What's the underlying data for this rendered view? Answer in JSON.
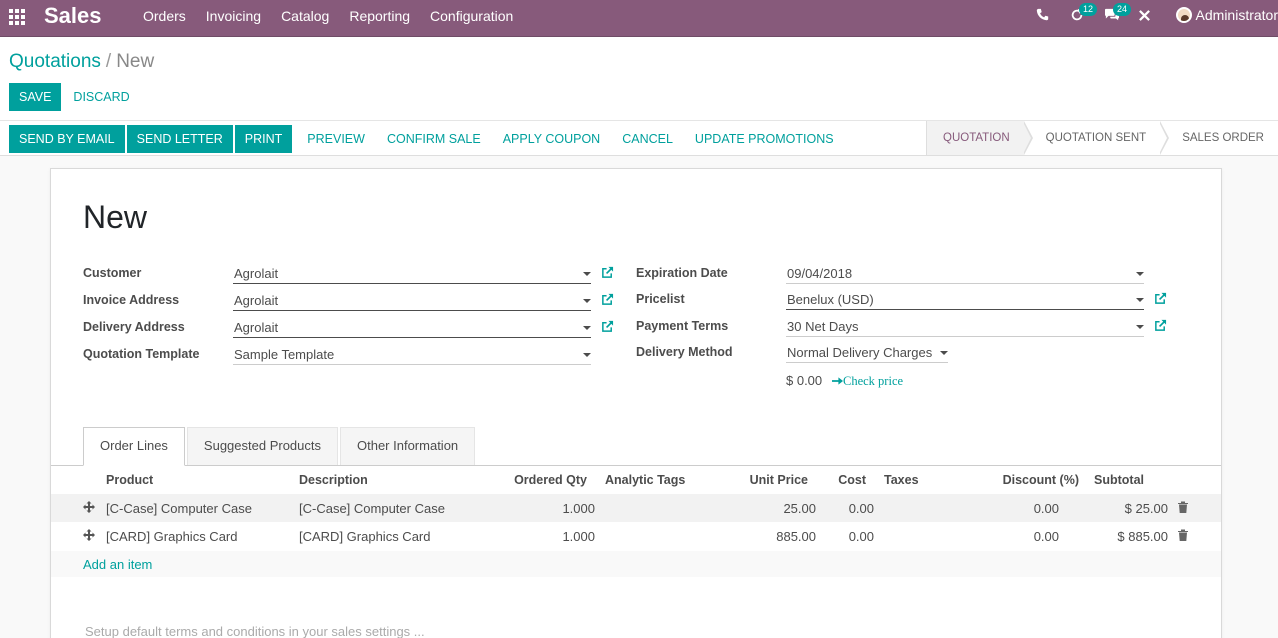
{
  "navbar": {
    "app_title": "Sales",
    "menu": [
      "Orders",
      "Invoicing",
      "Catalog",
      "Reporting",
      "Configuration"
    ],
    "activity_count": "12",
    "messages_count": "24",
    "user": "Administrator"
  },
  "breadcrumb": {
    "parent": "Quotations",
    "separator": "/",
    "current": "New"
  },
  "buttons": {
    "save": "Save",
    "discard": "Discard"
  },
  "actions": [
    "Send by Email",
    "Send Letter",
    "Print",
    "Preview",
    "Confirm Sale",
    "Apply Coupon",
    "Cancel",
    "Update Promotions"
  ],
  "stages": [
    "Quotation",
    "Quotation Sent",
    "Sales Order"
  ],
  "active_stage": "Quotation",
  "form": {
    "title": "New",
    "left": [
      {
        "label": "Customer",
        "value": "Agrolait"
      },
      {
        "label": "Invoice Address",
        "value": "Agrolait"
      },
      {
        "label": "Delivery Address",
        "value": "Agrolait"
      },
      {
        "label": "Quotation Template",
        "value": "Sample Template"
      }
    ],
    "right": [
      {
        "label": "Expiration Date",
        "value": "09/04/2018"
      },
      {
        "label": "Pricelist",
        "value": "Benelux (USD)"
      },
      {
        "label": "Payment Terms",
        "value": "30 Net Days"
      },
      {
        "label": "Delivery Method",
        "value": "Normal Delivery Charges"
      }
    ],
    "delivery_price": "$ 0.00",
    "check_price": "Check price"
  },
  "tabs": [
    "Order Lines",
    "Suggested Products",
    "Other Information"
  ],
  "table": {
    "headers": [
      "Product",
      "Description",
      "Ordered Qty",
      "Analytic Tags",
      "Unit Price",
      "Cost",
      "Taxes",
      "Discount (%)",
      "Subtotal"
    ],
    "rows": [
      {
        "product": "[C-Case] Computer Case",
        "description": "[C-Case] Computer Case",
        "qty": "1.000",
        "tags": "",
        "unit_price": "25.00",
        "cost": "0.00",
        "taxes": "",
        "discount": "0.00",
        "subtotal": "$ 25.00"
      },
      {
        "product": "[CARD] Graphics Card",
        "description": "[CARD] Graphics Card",
        "qty": "1.000",
        "tags": "",
        "unit_price": "885.00",
        "cost": "0.00",
        "taxes": "",
        "discount": "0.00",
        "subtotal": "$ 885.00"
      }
    ],
    "add_item": "Add an item"
  },
  "terms_placeholder": "Setup default terms and conditions in your sales settings ...",
  "colors": {
    "brand": "#875a7b",
    "accent": "#00a09d"
  },
  "icons": {
    "apps": "apps-grid-icon",
    "phone": "phone-icon",
    "activity": "refresh-icon",
    "messages": "chat-icon",
    "close": "close-icon",
    "external": "external-link-icon",
    "drag": "drag-handle-icon",
    "delete": "trash-icon"
  }
}
